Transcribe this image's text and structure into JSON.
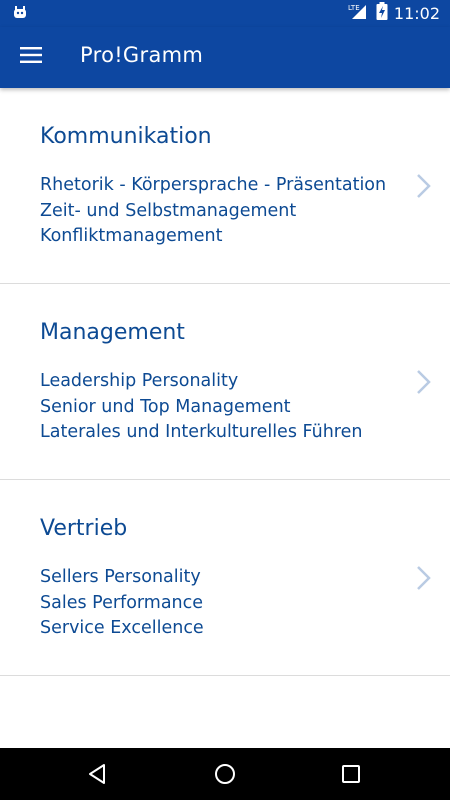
{
  "status_bar": {
    "time": "11:02",
    "network_label": "LTE",
    "icons": [
      "android-debug-icon",
      "lte-signal-icon",
      "battery-charging-icon"
    ]
  },
  "app_bar": {
    "title": "Pro!Gramm",
    "menu_icon": "hamburger-menu-icon",
    "color": "#0d47a1"
  },
  "sections": [
    {
      "title": "Kommunikation",
      "items": [
        "Rhetorik - Körpersprache - Präsentation",
        "Zeit- und Selbstmanagement",
        "Konfliktmanagement"
      ]
    },
    {
      "title": "Management",
      "items": [
        "Leadership Personality",
        "Senior und Top Management",
        "Laterales und Interkulturelles Führen"
      ]
    },
    {
      "title": "Vertrieb",
      "items": [
        "Sellers Personality",
        "Sales Performance",
        "Service Excellence"
      ]
    }
  ],
  "colors": {
    "primary": "#0d47a1",
    "text_accent": "#0d4a93",
    "chevron": "#b9cbe3",
    "divider": "#dcdcdc"
  },
  "nav_bar": {
    "icons": [
      "back-icon",
      "home-icon",
      "recent-apps-icon"
    ]
  }
}
